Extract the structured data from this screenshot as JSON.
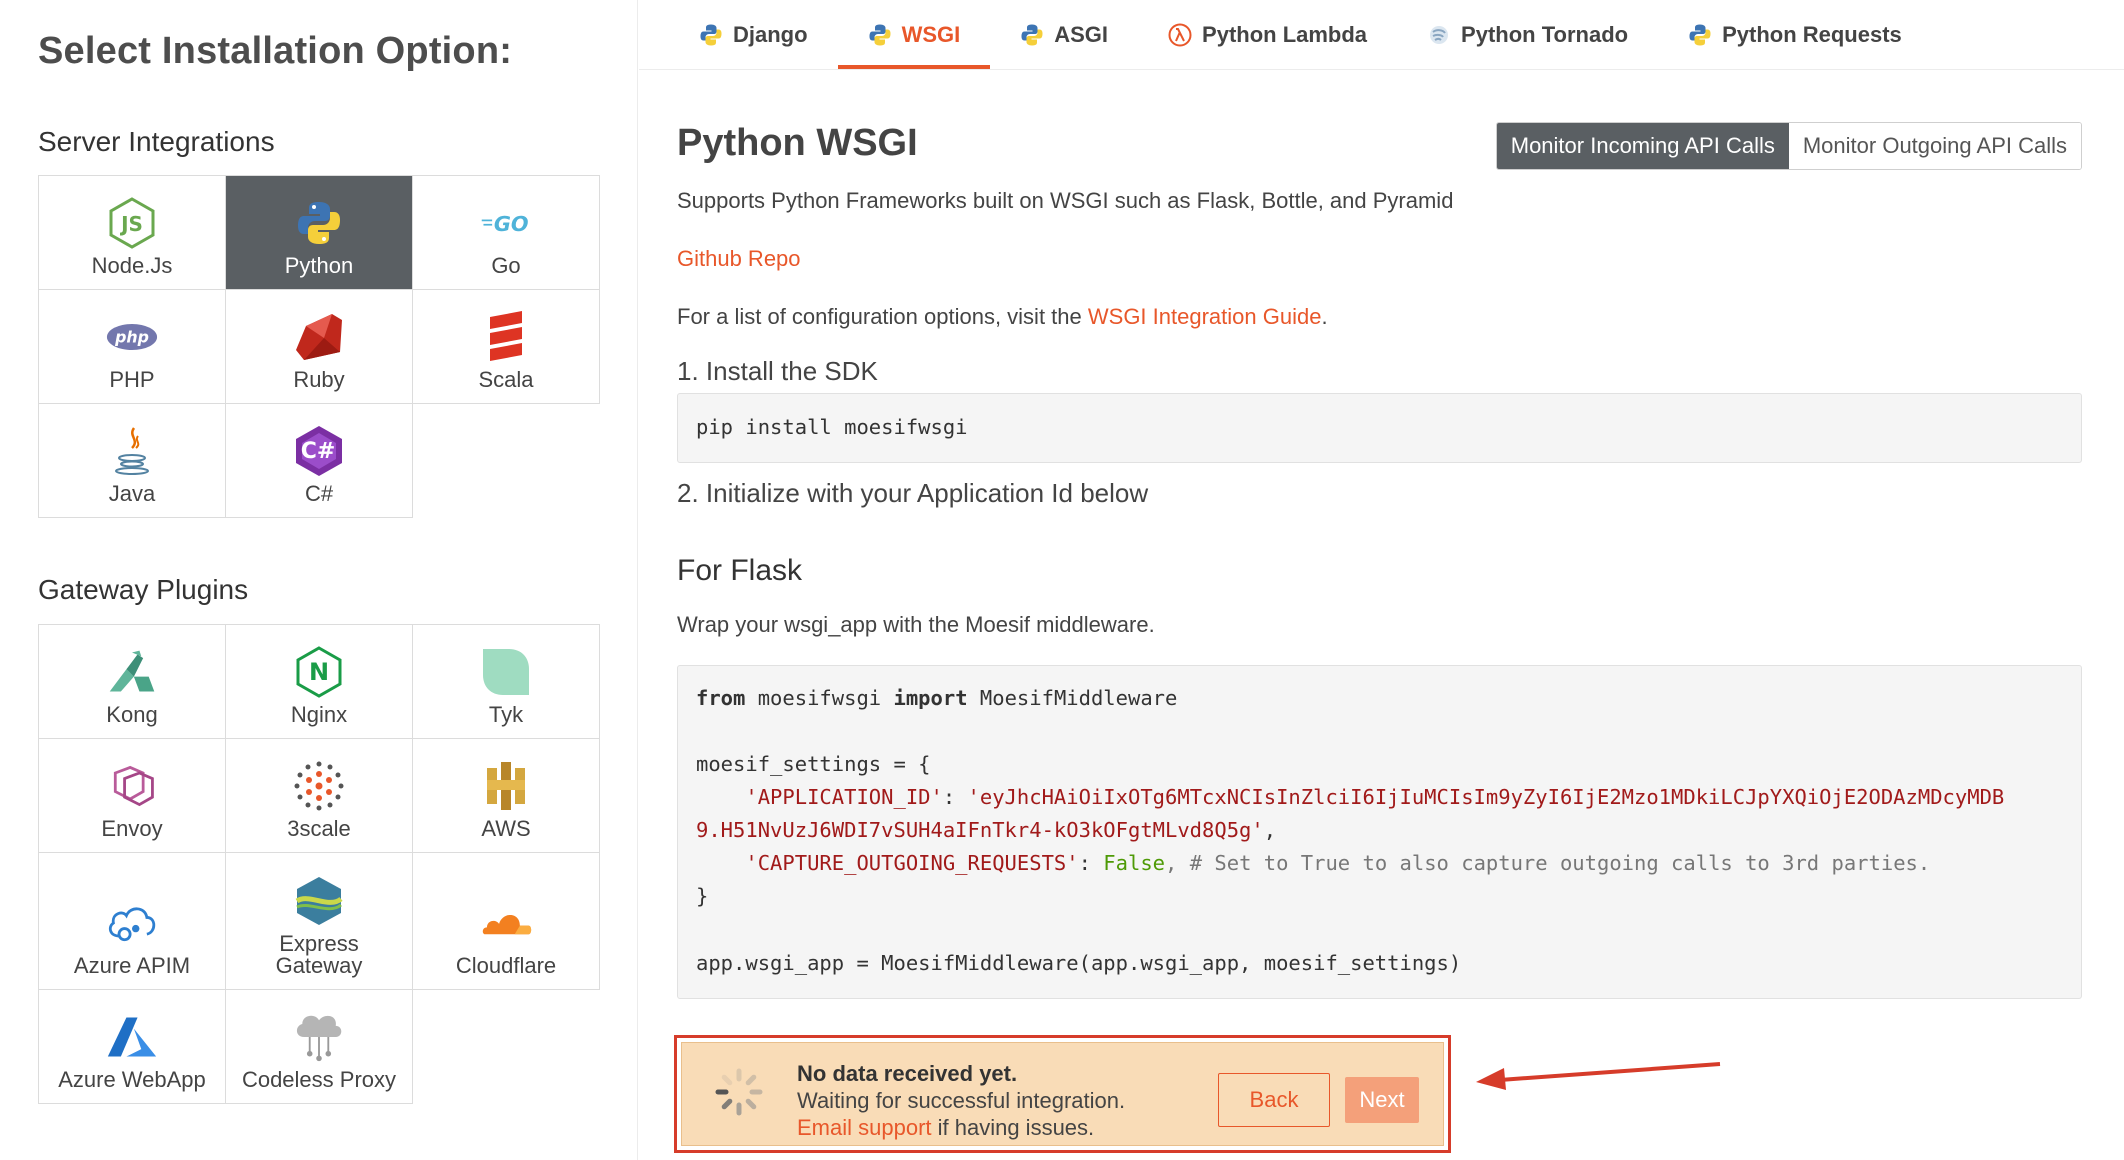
{
  "left": {
    "heading": "Select Installation Option:",
    "server_title": "Server Integrations",
    "server_items": [
      {
        "label": "Node.Js"
      },
      {
        "label": "Python"
      },
      {
        "label": "Go"
      },
      {
        "label": "PHP"
      },
      {
        "label": "Ruby"
      },
      {
        "label": "Scala"
      },
      {
        "label": "Java"
      },
      {
        "label": "C#"
      }
    ],
    "gateway_title": "Gateway Plugins",
    "gateway_items": [
      {
        "label": "Kong"
      },
      {
        "label": "Nginx"
      },
      {
        "label": "Tyk"
      },
      {
        "label": "Envoy"
      },
      {
        "label": "3scale"
      },
      {
        "label": "AWS"
      },
      {
        "label": "Azure APIM"
      },
      {
        "label": "Express Gateway"
      },
      {
        "label": "Cloudflare"
      },
      {
        "label": "Azure WebApp"
      },
      {
        "label": "Codeless Proxy"
      }
    ]
  },
  "tabs": [
    {
      "label": "Django"
    },
    {
      "label": "WSGI"
    },
    {
      "label": "ASGI"
    },
    {
      "label": "Python Lambda"
    },
    {
      "label": "Python Tornado"
    },
    {
      "label": "Python Requests"
    }
  ],
  "main": {
    "title": "Python WSGI",
    "toggle_incoming": "Monitor Incoming API Calls",
    "toggle_outgoing": "Monitor Outgoing API Calls",
    "desc": "Supports Python Frameworks built on WSGI such as Flask, Bottle, and Pyramid",
    "github": "Github Repo",
    "config_prefix": "For a list of configuration options, visit the ",
    "config_link": "WSGI Integration Guide",
    "config_suffix": ".",
    "step1": "1. Install the SDK",
    "install_cmd": "pip install moesifwsgi",
    "step2": "2. Initialize with your Application Id below",
    "flask_title": "For Flask",
    "flask_desc": "Wrap your wsgi_app with the Moesif middleware.",
    "code": {
      "l1_from": "from",
      "l1_mod": " moesifwsgi ",
      "l1_import": "import",
      "l1_cls": " MoesifMiddleware",
      "l2": "moesif_settings = {",
      "l3_key": "    'APPLICATION_ID'",
      "l3_colon": ": ",
      "l3_val_a": "'eyJhcHAiOiIxOTg6MTcxNCIsInZlciI6IjIuMCIsIm9yZyI6IjE2Mzo1MDkiLCJpYXQiOjE2ODAzMDcyMDB",
      "l4_val_b": "9.H51NvUzJ6WDI7vSUH4aIFnTkr4-kO3kOFgtMLvd8Q5g'",
      "l4_comma": ",",
      "l5_key": "    'CAPTURE_OUTGOING_REQUESTS'",
      "l5_colon": ": ",
      "l5_bool": "False",
      "l5_comment": ", # Set to True to also capture outgoing calls to 3rd parties.",
      "l6": "}",
      "l7": "app.wsgi_app = MoesifMiddleware(app.wsgi_app, moesif_settings)"
    }
  },
  "status": {
    "line1": "No data received yet.",
    "line2": "Waiting for successful integration.",
    "email_link": "Email support",
    "line3_suffix": " if having issues.",
    "back": "Back",
    "next": "Next"
  },
  "colors": {
    "accent": "#e8572a",
    "active_tile": "#5a5f63",
    "status_bg": "#f9dcb7",
    "highlight_border": "#d63c2a"
  }
}
